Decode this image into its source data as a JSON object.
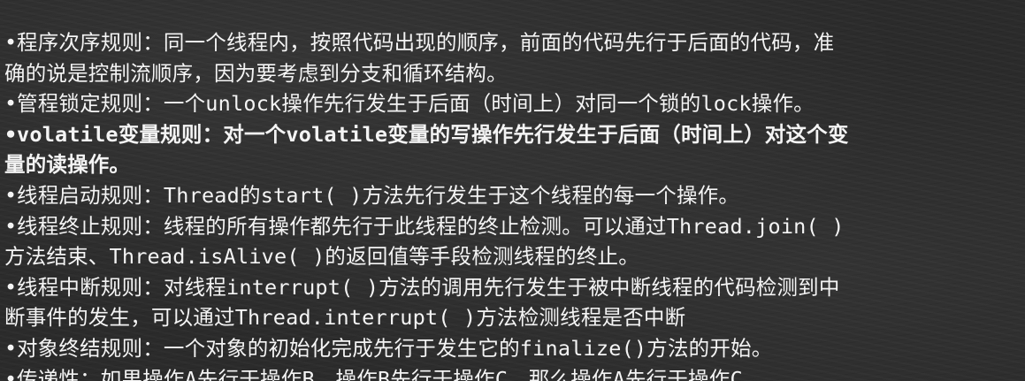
{
  "bullet": "•",
  "rules": [
    {
      "lines": [
        "程序次序规则：同一个线程内，按照代码出现的顺序，前面的代码先行于后面的代码，准",
        "确的说是控制流顺序，因为要考虑到分支和循环结构。"
      ]
    },
    {
      "lines": [
        "管程锁定规则：一个unlock操作先行发生于后面（时间上）对同一个锁的lock操作。"
      ]
    },
    {
      "lines": [
        "volatile变量规则：对一个volatile变量的写操作先行发生于后面（时间上）对这个变",
        "量的读操作。"
      ]
    },
    {
      "lines": [
        "线程启动规则：Thread的start( )方法先行发生于这个线程的每一个操作。"
      ]
    },
    {
      "lines": [
        "线程终止规则：线程的所有操作都先行于此线程的终止检测。可以通过Thread.join( )",
        "方法结束、Thread.isAlive( )的返回值等手段检测线程的终止。"
      ]
    },
    {
      "lines": [
        "线程中断规则：对线程interrupt( )方法的调用先行发生于被中断线程的代码检测到中",
        "断事件的发生，可以通过Thread.interrupt( )方法检测线程是否中断"
      ]
    },
    {
      "lines": [
        "对象终结规则：一个对象的初始化完成先行于发生它的finalize()方法的开始。"
      ]
    },
    {
      "lines": [
        "传递性：如果操作A先行于操作B，操作B先行于操作C，那么操作A先行于操作C"
      ]
    }
  ]
}
